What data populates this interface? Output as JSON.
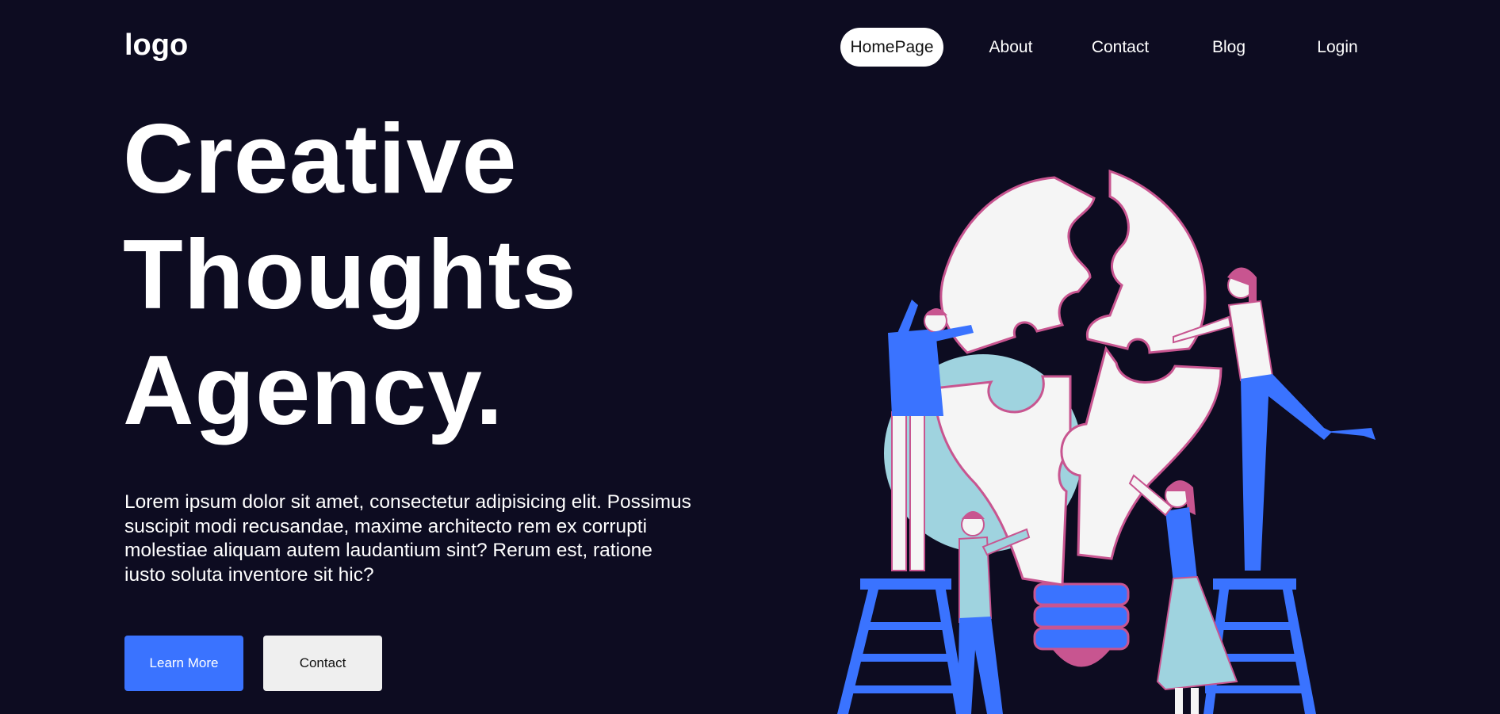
{
  "header": {
    "logo": "logo",
    "nav": [
      {
        "label": "HomePage",
        "active": true
      },
      {
        "label": "About",
        "active": false
      },
      {
        "label": "Contact",
        "active": false
      },
      {
        "label": "Blog",
        "active": false
      },
      {
        "label": "Login",
        "active": false
      }
    ]
  },
  "hero": {
    "title_lines": [
      "Creative",
      "Thoughts",
      "Agency."
    ],
    "paragraph": "Lorem ipsum dolor sit amet, consectetur adipisicing elit. Possimus suscipit modi recusandae, maxime architecto rem ex corrupti molestiae aliquam autem laudantium sint? Rerum est, ratione iusto soluta inventore sit hic?",
    "primary_button": "Learn More",
    "secondary_button": "Contact"
  },
  "colors": {
    "background": "#0d0c21",
    "accent_blue": "#3a73ff",
    "accent_pink": "#c85590",
    "light_blue": "#9fd3df",
    "off_white": "#f5f5f5"
  },
  "illustration": {
    "subject": "people-assembling-lightbulb-puzzle"
  }
}
